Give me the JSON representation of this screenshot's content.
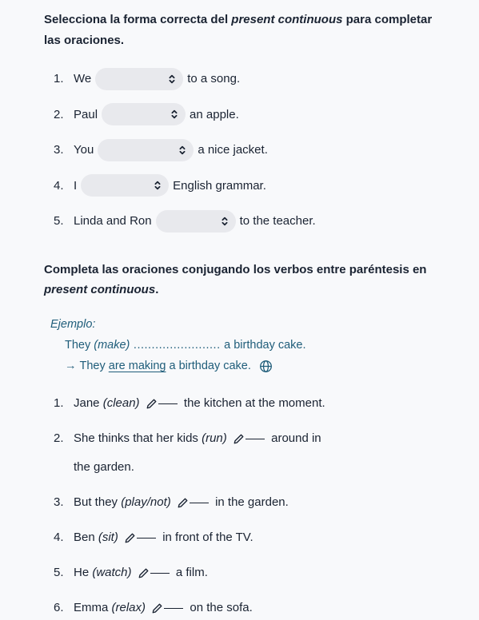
{
  "section1": {
    "instruction_pre": "Selecciona la forma correcta del ",
    "instruction_em": "present continuous",
    "instruction_post": " para completar las oraciones.",
    "items": [
      {
        "num": "1.",
        "before": "We",
        "after": "to a song."
      },
      {
        "num": "2.",
        "before": "Paul",
        "after": "an apple."
      },
      {
        "num": "3.",
        "before": "You",
        "after": "a nice jacket."
      },
      {
        "num": "4.",
        "before": "I",
        "after": "English grammar."
      },
      {
        "num": "5.",
        "before": "Linda and Ron",
        "after": "to the teacher."
      }
    ]
  },
  "section2": {
    "instruction_pre": "Completa las oraciones conjugando los verbos entre paréntesis en ",
    "instruction_em": "present continuous",
    "instruction_post": ".",
    "example": {
      "label": "Ejemplo:",
      "line1_pre": "They ",
      "line1_verb": "(make)",
      "line1_dots": " ........................ ",
      "line1_post": "a birthday cake.",
      "arrow": "→",
      "line2_pre": "They ",
      "line2_underlined": "are making",
      "line2_post": " a birthday cake."
    },
    "items": [
      {
        "num": "1.",
        "pre": "Jane ",
        "verb": "(clean)",
        "post": " the kitchen at the moment."
      },
      {
        "num": "2.",
        "pre": "She thinks that her kids ",
        "verb": "(run)",
        "post": " around in",
        "wrap": "the garden."
      },
      {
        "num": "3.",
        "pre": "But they ",
        "verb": "(play/not)",
        "post": " in the garden."
      },
      {
        "num": "4.",
        "pre": "Ben ",
        "verb": "(sit)",
        "post": " in front of the TV."
      },
      {
        "num": "5.",
        "pre": "He ",
        "verb": "(watch)",
        "post": " a film."
      },
      {
        "num": "6.",
        "pre": "Emma ",
        "verb": "(relax)",
        "post": " on the sofa."
      }
    ]
  }
}
